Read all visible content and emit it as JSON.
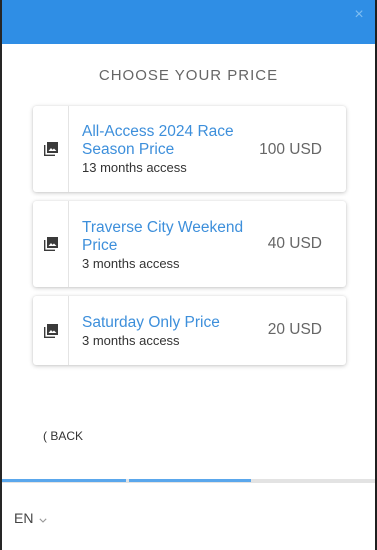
{
  "heading": "CHOOSE YOUR PRICE",
  "close_symbol": "×",
  "prices": [
    {
      "name": "All-Access 2024 Race Season Price",
      "access": "13 months access",
      "price": "100 USD"
    },
    {
      "name": "Traverse City Weekend Price",
      "access": "3 months access",
      "price": "40 USD"
    },
    {
      "name": "Saturday Only Price",
      "access": "3 months access",
      "price": "20 USD"
    }
  ],
  "back_label": "( BACK",
  "language": "EN",
  "icons": {
    "card": "image-gallery-icon",
    "close": "close-icon",
    "language": "chevron-down-icon"
  },
  "colors": {
    "topbar": "#2f8ee5",
    "accent": "#3d8fdb",
    "progress": "#5aa7ec"
  },
  "progress": {
    "steps": 3,
    "completed": 2
  }
}
